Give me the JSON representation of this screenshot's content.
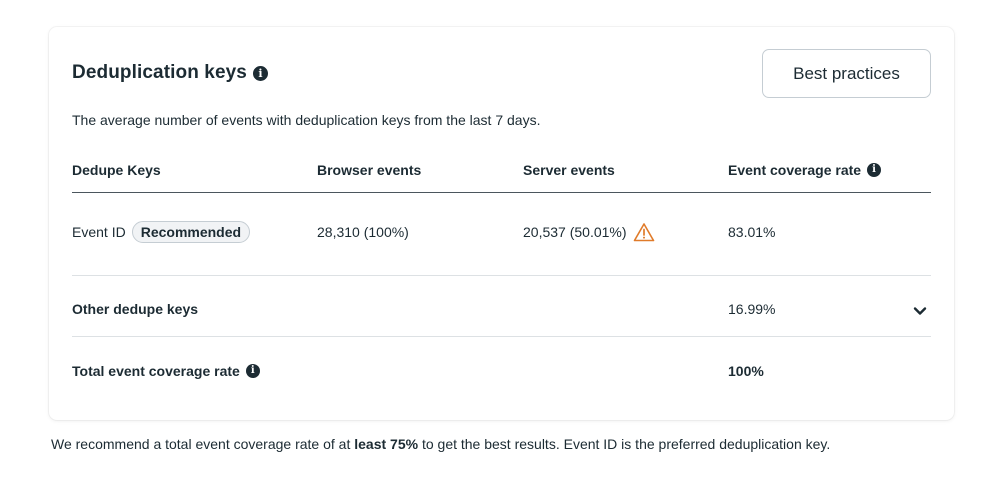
{
  "panel": {
    "title": "Deduplication keys",
    "title_info_icon": "info-icon",
    "best_practices_label": "Best practices",
    "subtitle": "The average number of events with deduplication keys from the last 7 days."
  },
  "table": {
    "headers": {
      "dedupe_keys": "Dedupe Keys",
      "browser_events": "Browser events",
      "server_events": "Server events",
      "coverage_rate": "Event coverage rate"
    },
    "event_id_row": {
      "key": "Event ID",
      "badge": "Recommended",
      "browser": "28,310 (100%)",
      "server": "20,537 (50.01%)",
      "server_icon": "warning-icon",
      "coverage": "83.01%"
    },
    "other_row": {
      "label": "Other dedupe keys",
      "coverage": "16.99%",
      "expand_icon": "chevron-down-icon"
    },
    "total_row": {
      "label": "Total event coverage rate",
      "coverage": "100%"
    }
  },
  "footer": {
    "text_before": "We recommend a total event coverage rate of at ",
    "text_bold": "least 75%",
    "text_after": " to get the best results. Event ID is the preferred deduplication key."
  },
  "colors": {
    "text": "#1c2b33",
    "warning": "#e07b2a",
    "border": "#c5cdd3"
  }
}
